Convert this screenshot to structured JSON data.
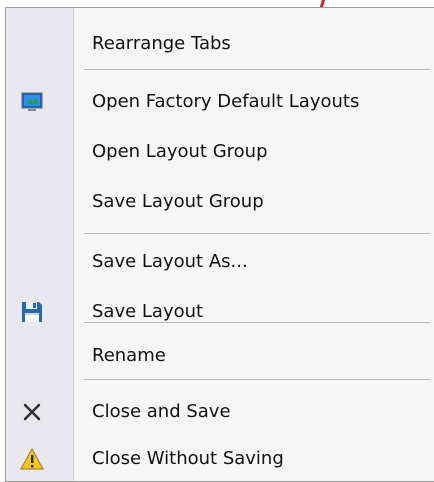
{
  "menu": {
    "items": [
      {
        "label": "Rearrange Tabs",
        "icon": ""
      },
      {
        "label": "Open Factory Default Layouts",
        "icon": "monitor-layout-icon"
      },
      {
        "label": "Open Layout Group",
        "icon": ""
      },
      {
        "label": "Save Layout Group",
        "icon": ""
      },
      {
        "label": "Save Layout As...",
        "icon": ""
      },
      {
        "label": "Save Layout",
        "icon": "floppy-disk-icon"
      },
      {
        "label": "Rename",
        "icon": ""
      },
      {
        "label": "Close and Save",
        "icon": "close-x-icon"
      },
      {
        "label": "Close Without Saving",
        "icon": "warning-triangle-icon"
      }
    ]
  },
  "colors": {
    "menu_background": "#f6f6f6",
    "gutter": "#e8e8ee",
    "separator": "#b8b8b8",
    "text": "#111111",
    "annotation_arrow": "#cc2222"
  }
}
